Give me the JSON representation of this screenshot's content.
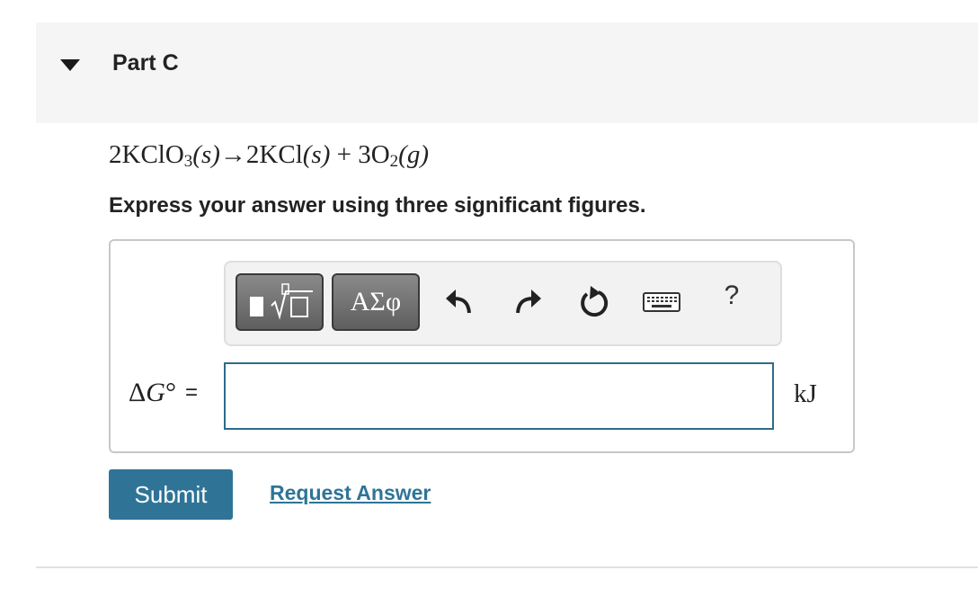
{
  "part": {
    "title": "Part C",
    "collapse_icon": "caret-down-icon"
  },
  "equation": {
    "reactant_coef": "2",
    "reactant": "KClO",
    "reactant_sub": "3",
    "reactant_state": "(s)",
    "arrow": "→",
    "product1_coef": "2",
    "product1": "KCl",
    "product1_state": "(s)",
    "plus": "+",
    "product2_coef": "3",
    "product2": "O",
    "product2_sub": "2",
    "product2_state": "(g)"
  },
  "instructions": "Express your answer using three significant figures.",
  "toolbar": {
    "templates_icon": "templates-icon",
    "greek_label": "ΑΣφ",
    "undo_icon": "undo-icon",
    "redo_icon": "redo-icon",
    "reset_icon": "reset-icon",
    "keyboard_icon": "keyboard-icon",
    "help_label": "?"
  },
  "answer": {
    "label_delta": "Δ",
    "label_var": "G",
    "label_sup": "°",
    "label_equals": "=",
    "value": "",
    "unit": "kJ"
  },
  "actions": {
    "submit_label": "Submit",
    "request_label": "Request Answer"
  },
  "colors": {
    "accent": "#2f7496",
    "header_bg": "#f5f5f5",
    "input_border": "#2e6b8a"
  }
}
